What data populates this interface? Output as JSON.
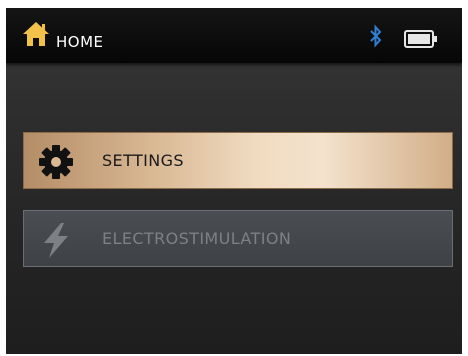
{
  "header": {
    "title": "HOME",
    "home_icon": "home-icon",
    "bluetooth_icon": "bluetooth-icon",
    "battery_icon": "battery-icon"
  },
  "menu": {
    "items": [
      {
        "label": "SETTINGS",
        "icon": "gear-icon",
        "state": "selected"
      },
      {
        "label": "ELECTROSTIMULATION",
        "icon": "lightning-icon",
        "state": "disabled"
      }
    ]
  },
  "colors": {
    "header_bg": "#0a0a0a",
    "screen_bg": "#2a2a2a",
    "selected_gold": "#e8cfae",
    "bluetooth_blue": "#2f7fd6",
    "disabled_text": "#7d8185"
  }
}
